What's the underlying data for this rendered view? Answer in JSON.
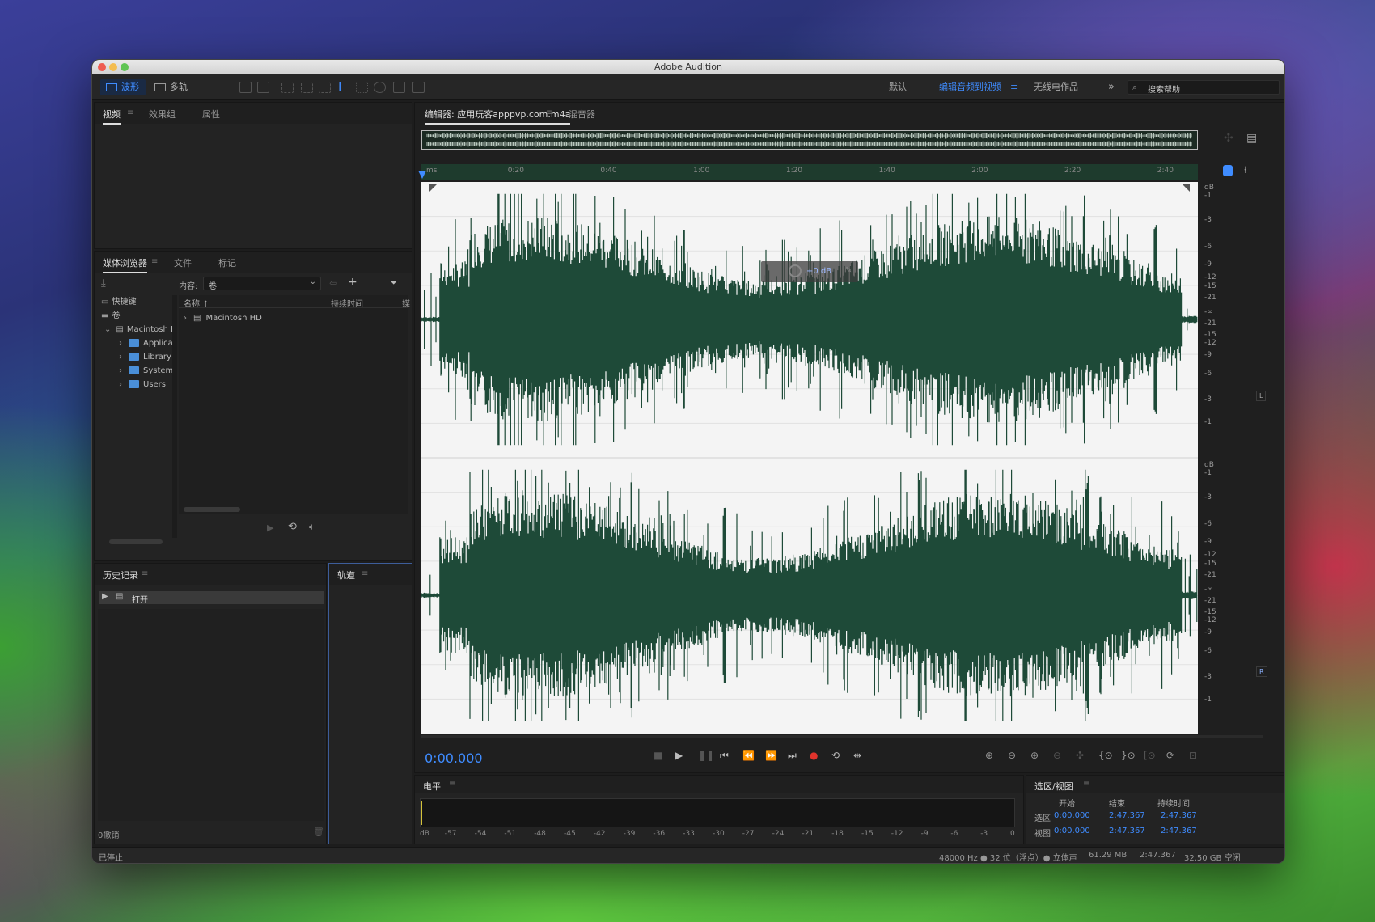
{
  "window": {
    "title": "Adobe Audition"
  },
  "toolbar": {
    "waveform_label": "波形",
    "multitrack_label": "多轨",
    "workspaces": [
      "默认",
      "编辑音频到视频",
      "无线电作品"
    ],
    "active_workspace": "编辑音频到视频",
    "more_label": "»",
    "search_placeholder": "搜索帮助"
  },
  "top_left_panel": {
    "tabs": [
      "视频",
      "效果组",
      "属性"
    ]
  },
  "media_browser": {
    "tabs": [
      "媒体浏览器",
      "文件",
      "标记"
    ],
    "content_label": "内容:",
    "content_value": "卷",
    "left_tree": [
      {
        "label": "快捷键",
        "icon": "shortcut-icon"
      },
      {
        "label": "卷",
        "icon": "drive-icon"
      },
      {
        "label": "Macintosh H",
        "icon": "disk-icon",
        "expanded": true
      },
      {
        "label": "Applica",
        "icon": "folder-icon"
      },
      {
        "label": "Library",
        "icon": "folder-icon"
      },
      {
        "label": "System",
        "icon": "folder-icon"
      },
      {
        "label": "Users",
        "icon": "folder-icon"
      }
    ],
    "columns": [
      "名称 ↑",
      "持续时间",
      "媒"
    ],
    "rows": [
      {
        "name": "Macintosh HD"
      }
    ]
  },
  "history": {
    "tab": "历史记录",
    "items": [
      "打开"
    ],
    "undo_count": "0撤销"
  },
  "tracks_panel": {
    "tab": "轨道"
  },
  "editor": {
    "tabs": [
      "编辑器: 应用玩客apppvp.com.m4a",
      "混音器"
    ],
    "ruler_unit": "ms",
    "ruler_ticks": [
      "0:20",
      "0:40",
      "1:00",
      "1:20",
      "1:40",
      "2:00",
      "2:20",
      "2:40"
    ],
    "hud_gain": "+0 dB",
    "db_scale_top": [
      "dB",
      "-1",
      "-3",
      "-6",
      "-9",
      "-12",
      "-15",
      "-21",
      "-∞",
      "-21",
      "-15",
      "-12",
      "-9",
      "-6",
      "-3",
      "-1"
    ],
    "channel_left": "L",
    "channel_right": "R",
    "waveform_color": "#1e4a38",
    "time_display": "0:00.000"
  },
  "level_meter": {
    "tab": "电平",
    "scale": [
      "dB",
      "-57",
      "-54",
      "-51",
      "-48",
      "-45",
      "-42",
      "-39",
      "-36",
      "-33",
      "-30",
      "-27",
      "-24",
      "-21",
      "-18",
      "-15",
      "-12",
      "-9",
      "-6",
      "-3",
      "0"
    ]
  },
  "selection_view": {
    "tab": "选区/视图",
    "headers": [
      "开始",
      "结束",
      "持续时间"
    ],
    "rows": [
      {
        "label": "选区",
        "start": "0:00.000",
        "end": "2:47.367",
        "duration": "2:47.367"
      },
      {
        "label": "视图",
        "start": "0:00.000",
        "end": "2:47.367",
        "duration": "2:47.367"
      }
    ]
  },
  "status_bar": {
    "state": "已停止",
    "format": "48000 Hz ● 32 位（浮点）● 立体声",
    "size": "61.29 MB",
    "duration": "2:47.367",
    "free": "32.50 GB 空闲"
  },
  "colors": {
    "accent": "#3f8cff",
    "record": "#e0332c",
    "waveform": "#1e4a38"
  }
}
